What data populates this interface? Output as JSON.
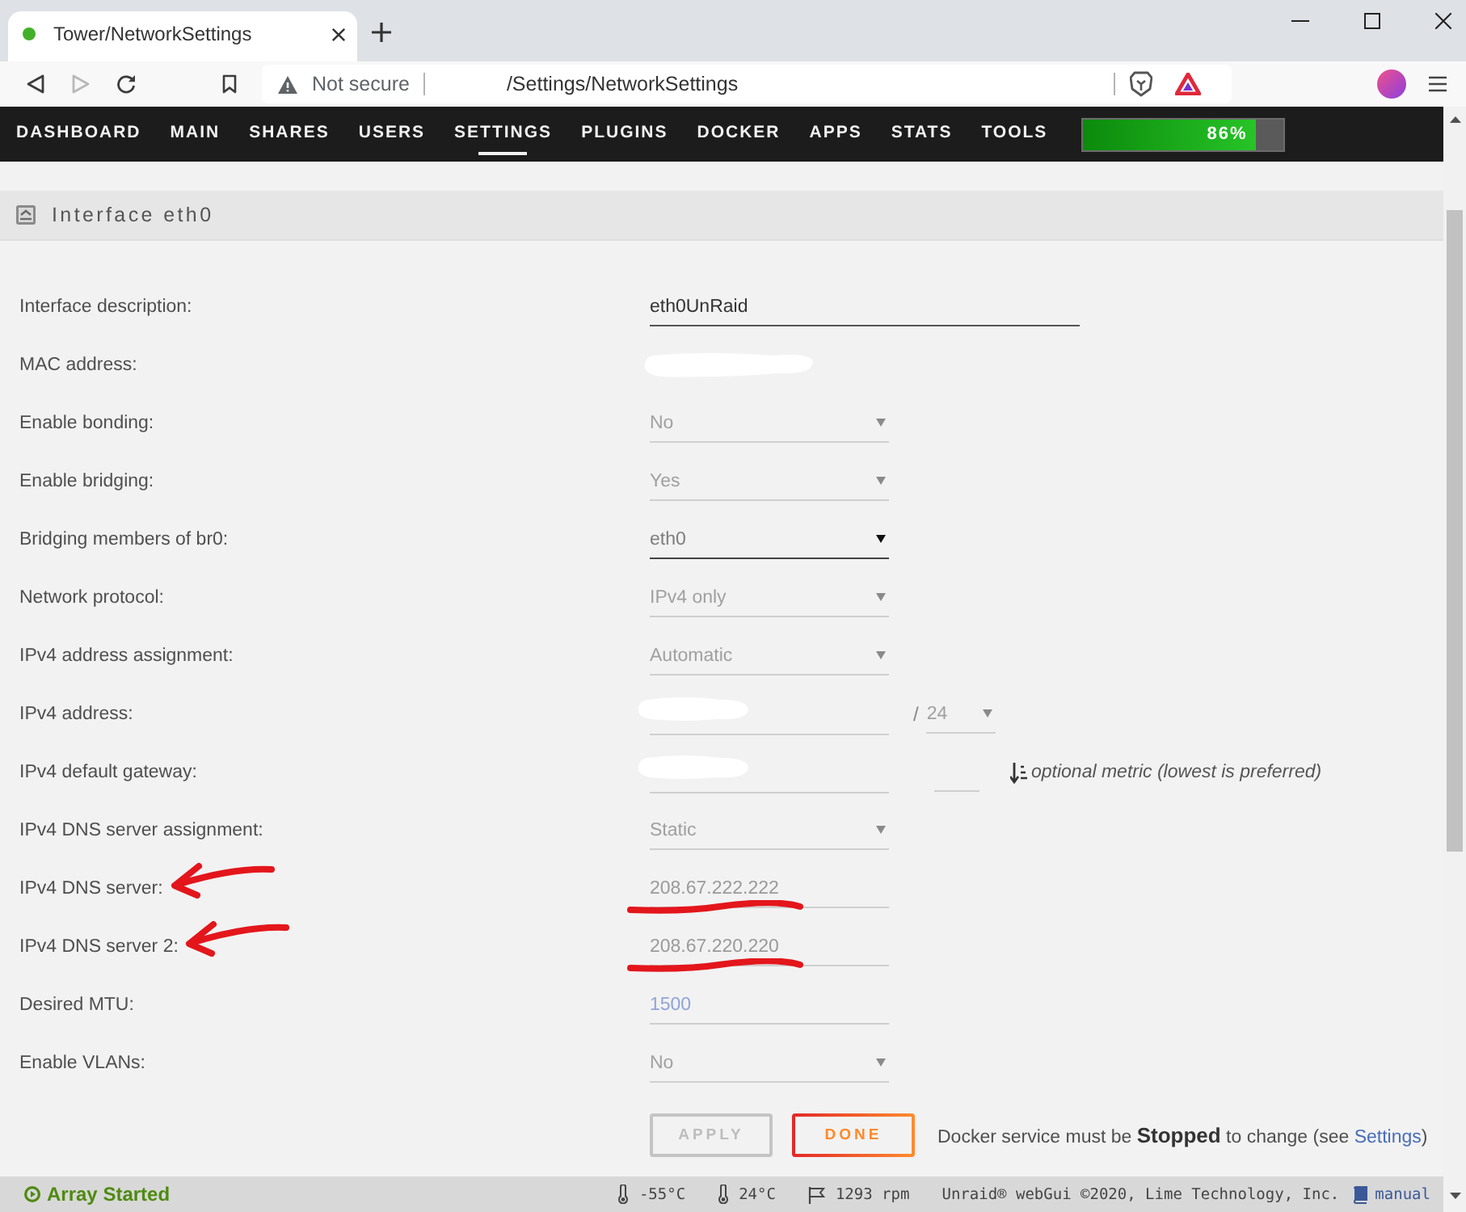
{
  "browser": {
    "tab": {
      "title": "Tower/NetworkSettings"
    },
    "nav_buttons": [
      {
        "kind": "back",
        "disabled": false
      },
      {
        "kind": "forward",
        "disabled": true
      },
      {
        "kind": "reload",
        "disabled": false
      }
    ],
    "address": {
      "security": "Not secure",
      "url": "/Settings/NetworkSettings"
    }
  },
  "nav": {
    "items": [
      {
        "label": "DASHBOARD",
        "selected": false
      },
      {
        "label": "MAIN",
        "selected": false
      },
      {
        "label": "SHARES",
        "selected": false
      },
      {
        "label": "USERS",
        "selected": false
      },
      {
        "label": "SETTINGS",
        "selected": true
      },
      {
        "label": "PLUGINS",
        "selected": false
      },
      {
        "label": "DOCKER",
        "selected": false
      },
      {
        "label": "APPS",
        "selected": false
      },
      {
        "label": "STATS",
        "selected": false
      },
      {
        "label": "TOOLS",
        "selected": false
      }
    ],
    "usage": {
      "level": 0.86,
      "text": "86%"
    }
  },
  "section": {
    "title": "Interface eth0"
  },
  "rows": [
    {
      "label": "Interface description:",
      "kind": "text",
      "value": "eth0UnRaid",
      "disabled": false,
      "redacted": false,
      "annotated": false
    },
    {
      "label": "MAC address:",
      "kind": "static",
      "redacted": true,
      "annotated": false
    },
    {
      "label": "Enable bonding:",
      "kind": "select",
      "value": "No",
      "disabled": true,
      "redacted": false,
      "annotated": false
    },
    {
      "label": "Enable bridging:",
      "kind": "select",
      "value": "Yes",
      "disabled": true,
      "redacted": false,
      "annotated": false
    },
    {
      "label": "Bridging members of br0:",
      "kind": "select",
      "value": "eth0",
      "disabled": false,
      "redacted": false,
      "annotated": false
    },
    {
      "label": "Network protocol:",
      "kind": "select",
      "value": "IPv4 only",
      "disabled": true,
      "redacted": false,
      "annotated": false
    },
    {
      "label": "IPv4 address assignment:",
      "kind": "select",
      "value": "Automatic",
      "disabled": true,
      "redacted": false,
      "annotated": false
    },
    {
      "label": "IPv4 address:",
      "kind": "field",
      "disabled": true,
      "redacted": true,
      "annotated": false,
      "prefix": {
        "separator": "/",
        "value": "24",
        "disabled": true
      }
    },
    {
      "label": "IPv4 default gateway:",
      "kind": "field",
      "disabled": true,
      "redacted": true,
      "annotated": false,
      "metric": {
        "disabled": true,
        "hint": "optional metric (lowest is preferred)"
      }
    },
    {
      "label": "IPv4 DNS server assignment:",
      "kind": "select",
      "value": "Static",
      "disabled": true,
      "redacted": false,
      "annotated": false
    },
    {
      "label": "IPv4 DNS server:",
      "kind": "field",
      "value": "208.67.222.222",
      "disabled": true,
      "redacted": false,
      "annotated": true
    },
    {
      "label": "IPv4 DNS server 2:",
      "kind": "field",
      "value": "208.67.220.220",
      "disabled": true,
      "redacted": false,
      "annotated": true
    },
    {
      "label": "Desired MTU:",
      "kind": "field",
      "placeholder": "1500",
      "disabled": true,
      "redacted": false,
      "annotated": false
    },
    {
      "label": "Enable VLANs:",
      "kind": "select",
      "value": "No",
      "disabled": true,
      "redacted": false,
      "annotated": false
    }
  ],
  "actions": {
    "buttons": [
      {
        "label": "APPLY",
        "disabled": true
      },
      {
        "label": "DONE",
        "disabled": false
      }
    ],
    "note": {
      "text": "Docker service must be **Stopped** to change (see",
      "link": "Settings",
      "end": ")"
    }
  },
  "footer": {
    "status": {
      "text": "Array Started",
      "started": true
    },
    "readings": [
      {
        "kind": "temperature",
        "text": "-55°C"
      },
      {
        "kind": "temperature",
        "text": "24°C"
      },
      {
        "kind": "fan",
        "text": "1293 rpm"
      }
    ],
    "copyright": "Unraid® webGui ©2020, Lime Technology, Inc.",
    "manual": "manual"
  }
}
